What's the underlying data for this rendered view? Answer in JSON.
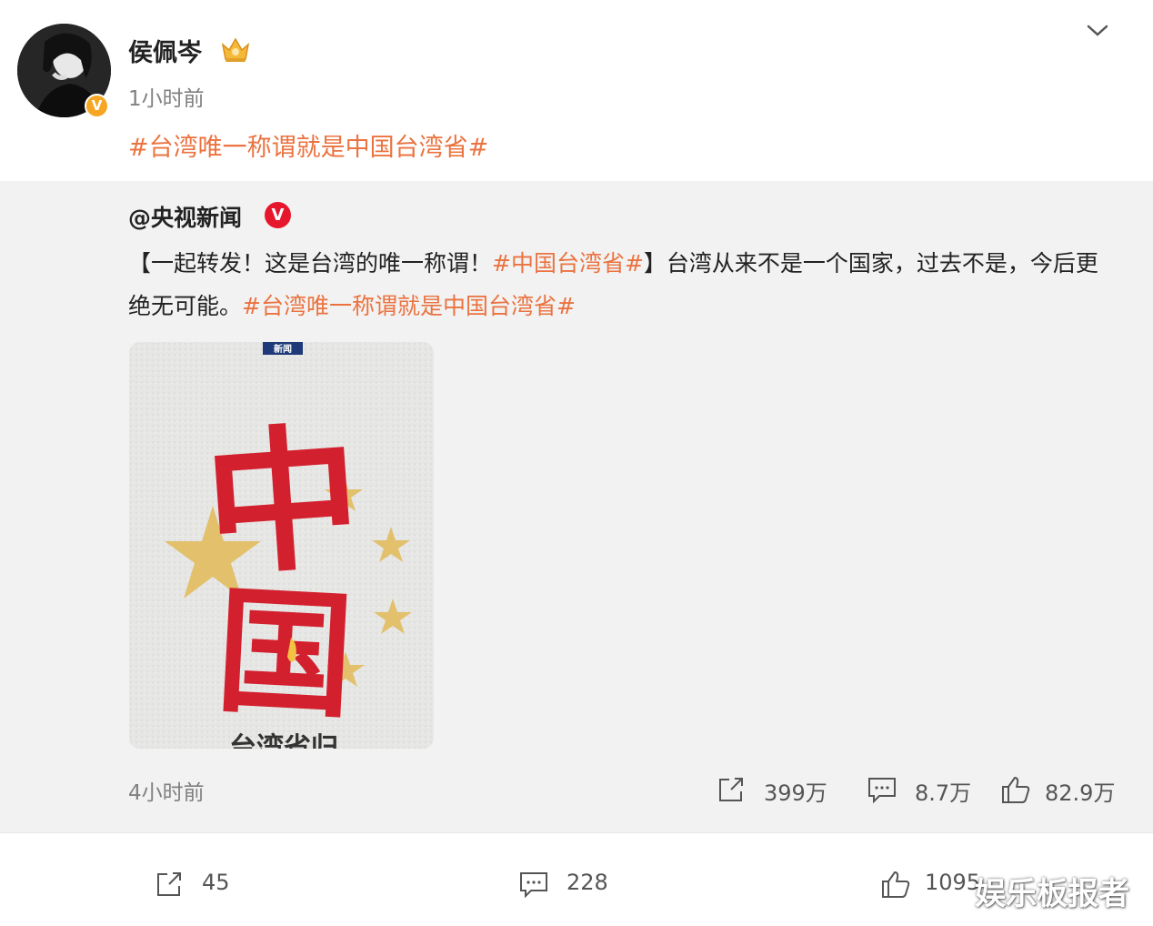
{
  "post": {
    "author": "侯佩岑",
    "time": "1小时前",
    "hashtag": "#台湾唯一称谓就是中国台湾省#",
    "verified_mark": "V"
  },
  "repost": {
    "author": "@央视新闻",
    "verified_mark": "V",
    "text_part1": "【一起转发！这是台湾的唯一称谓！",
    "tag1": "#中国台湾省#",
    "text_part2": "】台湾从来不是一个国家，过去不是，今后更绝无可能。",
    "tag2": "#台湾唯一称谓就是中国台湾省#",
    "time": "4小时前",
    "shares": "399万",
    "comments": "8.7万",
    "likes": "82.9万",
    "image": {
      "logo_text": "新闻",
      "big_char_1": "中",
      "big_char_2": "国",
      "bottom_text": "台湾省归"
    }
  },
  "actions": {
    "shares": "45",
    "comments": "228",
    "likes": "1095"
  },
  "watermark": "娱乐板报者",
  "colors": {
    "accent": "#eb7340",
    "verified_gold": "#f6a623",
    "verified_red": "#e6162d",
    "panel_bg": "#f2f2f2"
  }
}
